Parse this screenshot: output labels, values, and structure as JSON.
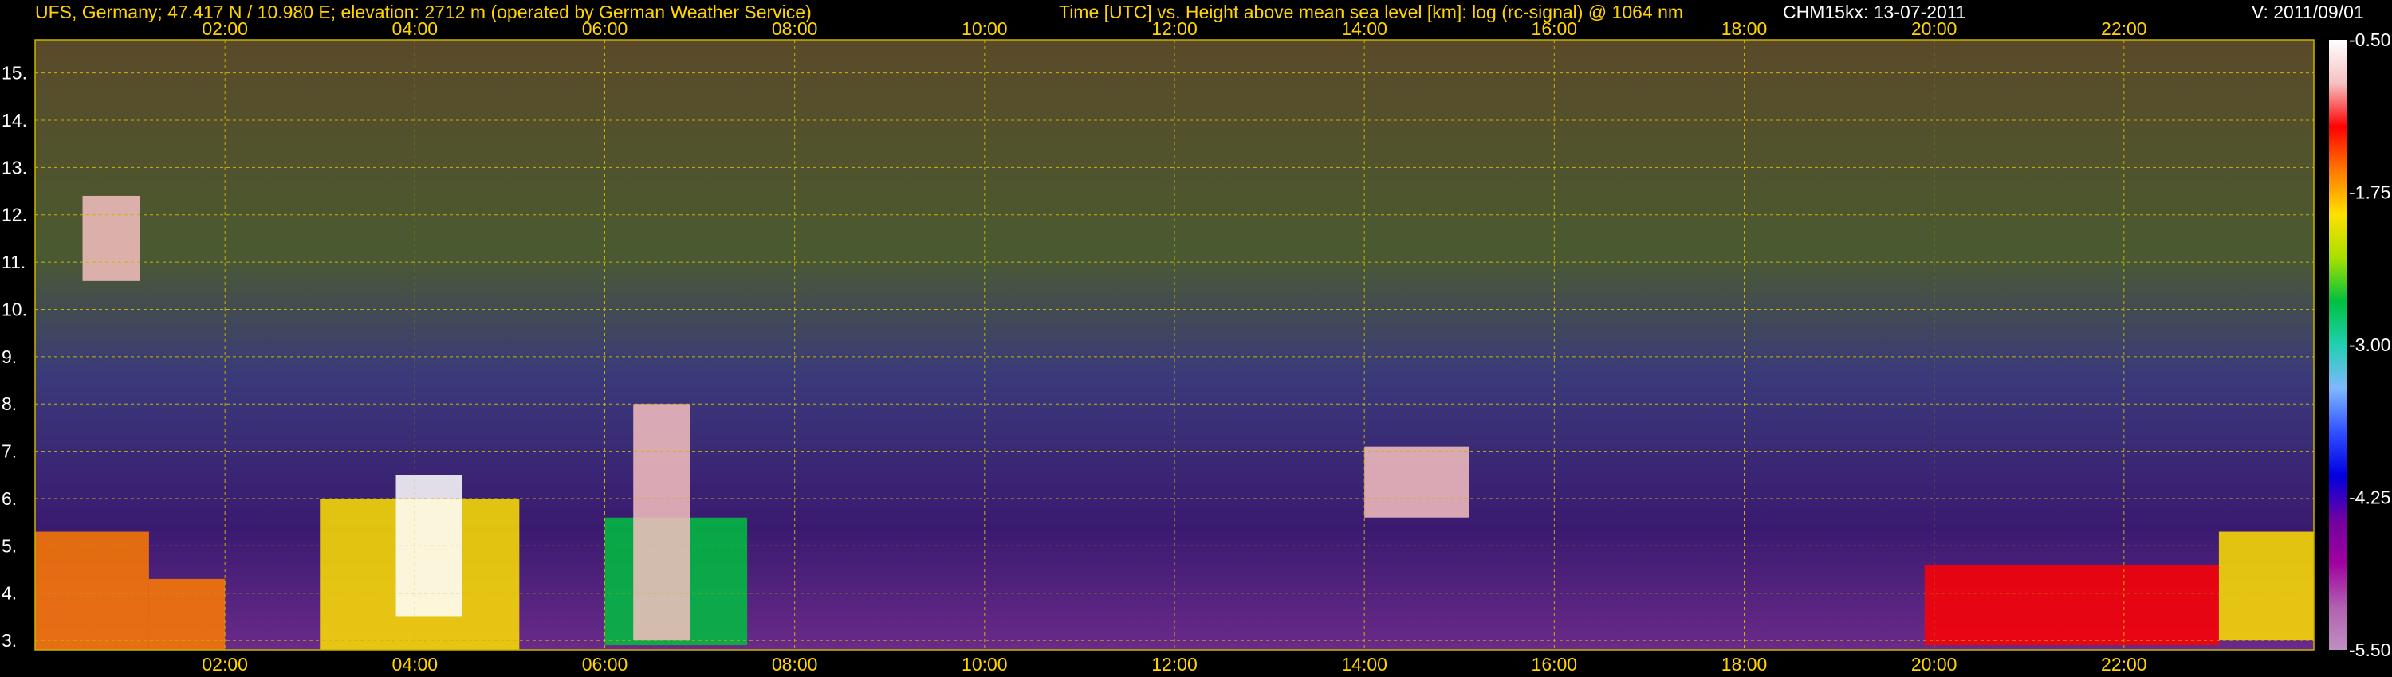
{
  "header": {
    "station": "UFS, Germany; 47.417 N / 10.980 E; elevation: 2712 m  (operated by German Weather Service)",
    "axes_desc": "Time [UTC] vs. Height above mean sea level [km]: log (rc-signal) @ 1064 nm",
    "instrument": "CHM15kx: 13-07-2011",
    "version": "V: 2011/09/01"
  },
  "colors": {
    "text": "#ffd400",
    "grid": "#c8b400",
    "background": "#000000"
  },
  "chart_data": {
    "type": "heatmap",
    "title": "Time [UTC] vs. Height above mean sea level [km]: log (rc-signal) @ 1064 nm",
    "xlabel": "",
    "ylabel": "",
    "x_ticks": [
      "02:00",
      "04:00",
      "06:00",
      "08:00",
      "10:00",
      "12:00",
      "14:00",
      "16:00",
      "18:00",
      "20:00",
      "22:00"
    ],
    "x_tick_hours": [
      2,
      4,
      6,
      8,
      10,
      12,
      14,
      16,
      18,
      20,
      22
    ],
    "xlim_hours": [
      0.0,
      24.0
    ],
    "y_ticks": [
      "3.",
      "4.",
      "5.",
      "6.",
      "7.",
      "8.",
      "9.",
      "10.",
      "11.",
      "12.",
      "13.",
      "14.",
      "15."
    ],
    "y_tick_values": [
      3,
      4,
      5,
      6,
      7,
      8,
      9,
      10,
      11,
      12,
      13,
      14,
      15
    ],
    "ylim_km": [
      2.8,
      15.7
    ],
    "grid": true,
    "colorbar": {
      "labels": [
        "-0.50",
        "-1.75",
        "-3.00",
        "-4.25",
        "-5.50"
      ],
      "values": [
        -0.5,
        -1.75,
        -3.0,
        -4.25,
        -5.5
      ],
      "colors": [
        "#ffffff",
        "#f6c0c0",
        "#ff0000",
        "#ff7a00",
        "#ffe000",
        "#a8e000",
        "#00c040",
        "#20d0b0",
        "#7fb8ff",
        "#3050ff",
        "#0000e0",
        "#7000a0",
        "#a000a0",
        "#b060b0",
        "#c090c0"
      ]
    },
    "layers": [
      {
        "t0": 0.0,
        "t1": 1.2,
        "h0": 2.8,
        "h1": 5.3,
        "value": -1.6
      },
      {
        "t0": 1.2,
        "t1": 2.0,
        "h0": 2.8,
        "h1": 4.3,
        "value": -1.7
      },
      {
        "t0": 3.0,
        "t1": 5.1,
        "h0": 2.8,
        "h1": 6.0,
        "value": -1.8
      },
      {
        "t0": 3.8,
        "t1": 4.5,
        "h0": 3.5,
        "h1": 6.5,
        "value": -0.6
      },
      {
        "t0": 6.0,
        "t1": 7.5,
        "h0": 2.9,
        "h1": 5.6,
        "value": -2.5
      },
      {
        "t0": 6.3,
        "t1": 6.9,
        "h0": 3.0,
        "h1": 8.0,
        "value": -1.0
      },
      {
        "t0": 0.5,
        "t1": 1.1,
        "h0": 10.6,
        "h1": 12.4,
        "value": -0.8
      },
      {
        "t0": 14.0,
        "t1": 15.1,
        "h0": 5.6,
        "h1": 7.1,
        "value": -1.0
      },
      {
        "t0": 19.9,
        "t1": 23.0,
        "h0": 2.9,
        "h1": 4.6,
        "value": -1.2
      },
      {
        "t0": 23.0,
        "t1": 24.0,
        "h0": 3.0,
        "h1": 5.3,
        "value": -2.0
      }
    ]
  }
}
